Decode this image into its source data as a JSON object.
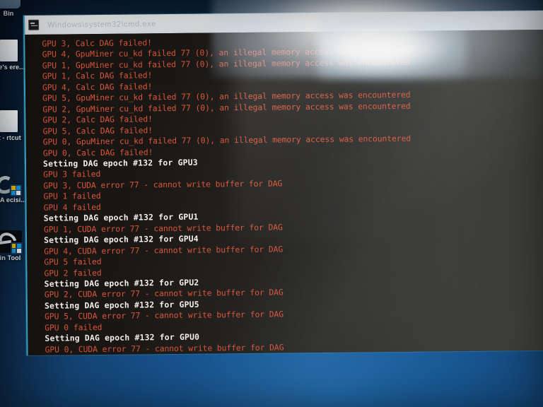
{
  "desktop": {
    "icons": [
      {
        "name": "recycle-bin",
        "label": "Bin"
      },
      {
        "name": "store-shortcut",
        "label": "ore's\nere..."
      },
      {
        "name": "shortcut-file",
        "label": "rt -\nrtcut"
      },
      {
        "name": "vga-driver-shortcut",
        "label": "VGA\necisi..."
      },
      {
        "name": "skin-tool-shortcut",
        "label": "kin Tool"
      }
    ]
  },
  "console": {
    "title": "Windows\\system32\\cmd.exe",
    "icon": "console-icon",
    "lines": [
      {
        "type": "err",
        "text": "GPU 3, Calc DAG failed!"
      },
      {
        "type": "err",
        "text": "GPU 4, GpuMiner cu_kd failed 77 (0), an illegal memory access was encountered"
      },
      {
        "type": "err",
        "text": "GPU 1, GpuMiner cu_kd failed 77 (0), an illegal memory access was encountered"
      },
      {
        "type": "err",
        "text": "GPU 1, Calc DAG failed!"
      },
      {
        "type": "err",
        "text": "GPU 4, Calc DAG failed!"
      },
      {
        "type": "err",
        "text": "GPU 5, GpuMiner cu_kd failed 77 (0), an illegal memory access was encountered"
      },
      {
        "type": "err",
        "text": "GPU 2, GpuMiner cu_kd failed 77 (0), an illegal memory access was encountered"
      },
      {
        "type": "err",
        "text": "GPU 2, Calc DAG failed!"
      },
      {
        "type": "err",
        "text": "GPU 5, Calc DAG failed!"
      },
      {
        "type": "err",
        "text": "GPU 0, GpuMiner cu_kd failed 77 (0), an illegal memory access was encountered"
      },
      {
        "type": "err",
        "text": "GPU 0, Calc DAG failed!"
      },
      {
        "type": "info",
        "text": "Setting DAG epoch #132 for GPU3"
      },
      {
        "type": "err",
        "text": "GPU 3 failed"
      },
      {
        "type": "err",
        "text": "GPU 3, CUDA error 77 - cannot write buffer for DAG"
      },
      {
        "type": "err",
        "text": "GPU 1 failed"
      },
      {
        "type": "err",
        "text": "GPU 4 failed"
      },
      {
        "type": "info",
        "text": "Setting DAG epoch #132 for GPU1"
      },
      {
        "type": "err",
        "text": "GPU 1, CUDA error 77 - cannot write buffer for DAG"
      },
      {
        "type": "info",
        "text": "Setting DAG epoch #132 for GPU4"
      },
      {
        "type": "err",
        "text": "GPU 4, CUDA error 77 - cannot write buffer for DAG"
      },
      {
        "type": "err",
        "text": "GPU 5 failed"
      },
      {
        "type": "err",
        "text": "GPU 2 failed"
      },
      {
        "type": "info",
        "text": "Setting DAG epoch #132 for GPU2"
      },
      {
        "type": "err",
        "text": "GPU 2, CUDA error 77 - cannot write buffer for DAG"
      },
      {
        "type": "info",
        "text": "Setting DAG epoch #132 for GPU5"
      },
      {
        "type": "err",
        "text": "GPU 5, CUDA error 77 - cannot write buffer for DAG"
      },
      {
        "type": "err",
        "text": "GPU 0 failed"
      },
      {
        "type": "info",
        "text": "Setting DAG epoch #132 for GPU0"
      },
      {
        "type": "err",
        "text": "GPU 0, CUDA error 77 - cannot write buffer for DAG"
      }
    ]
  },
  "colors": {
    "error_text": "#d8573c",
    "info_text": "#f3f1ee",
    "terminal_bg": "#1b1714",
    "window_border": "#3fb3d8",
    "desktop_blue": "#18538d",
    "titlebar_bg": "#eceef0"
  }
}
